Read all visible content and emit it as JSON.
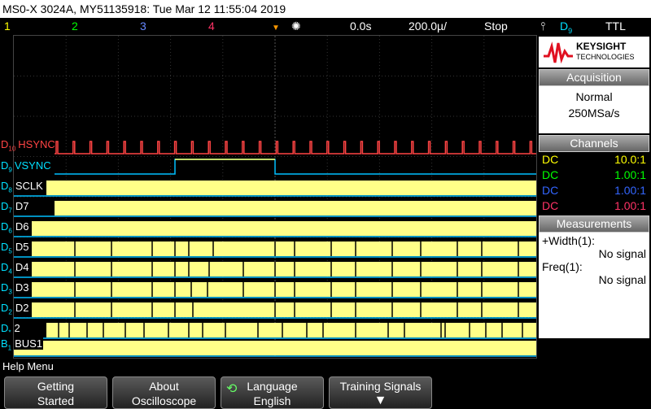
{
  "title": "MS0-X 3024A, MY51135918: Tue Mar 12 11:55:04 2019",
  "status": {
    "ch1": "1",
    "ch2": "2",
    "ch3": "3",
    "ch4": "4",
    "time_offset": "0.0s",
    "time_div": "200.0µ/",
    "run_state": "Stop",
    "trigger_src": "D",
    "trigger_sub": "9",
    "trigger_level": "TTL"
  },
  "logo": {
    "brand": "KEYSIGHT",
    "sub": "TECHNOLOGIES"
  },
  "acquisition": {
    "header": "Acquisition",
    "mode": "Normal",
    "rate": "250MSa/s"
  },
  "channels": {
    "header": "Channels",
    "rows": [
      {
        "coupling": "DC",
        "value": "10.0:1",
        "color": "#ffff00"
      },
      {
        "coupling": "DC",
        "value": "1.00:1",
        "color": "#00ff00"
      },
      {
        "coupling": "DC",
        "value": "1.00:1",
        "color": "#3366ff"
      },
      {
        "coupling": "DC",
        "value": "1.00:1",
        "color": "#ff3366"
      }
    ]
  },
  "measurements": {
    "header": "Measurements",
    "m1_label": "+Width(1):",
    "m1_value": "No signal",
    "m2_label": "Freq(1):",
    "m2_value": "No signal"
  },
  "traces": [
    {
      "pre": "D",
      "sub": "10",
      "name": "HSYNC"
    },
    {
      "pre": "D",
      "sub": "9",
      "name": "VSYNC"
    },
    {
      "pre": "D",
      "sub": "8",
      "name": "SCLK"
    },
    {
      "pre": "D",
      "sub": "7",
      "name": "D7"
    },
    {
      "pre": "D",
      "sub": "6",
      "name": "D6"
    },
    {
      "pre": "D",
      "sub": "5",
      "name": "D5"
    },
    {
      "pre": "D",
      "sub": "4",
      "name": "D4"
    },
    {
      "pre": "D",
      "sub": "3",
      "name": "D3"
    },
    {
      "pre": "D",
      "sub": "2",
      "name": "D2"
    },
    {
      "pre": "D",
      "sub": "*",
      "name": "2"
    },
    {
      "pre": "B",
      "sub": "1",
      "name": "BUS1"
    }
  ],
  "help": "Help Menu",
  "softkeys": {
    "k1_line1": "Getting",
    "k1_line2": "Started",
    "k2_line1": "About",
    "k2_line2": "Oscilloscope",
    "k3_line1": "Language",
    "k3_line2": "English",
    "k4_line1": "Training Signals"
  },
  "colors": {
    "hsync": "#ff4444",
    "vsync_line": "#00c0ff",
    "digital": "#ffff88",
    "label_cyan": "#00e0ff"
  }
}
